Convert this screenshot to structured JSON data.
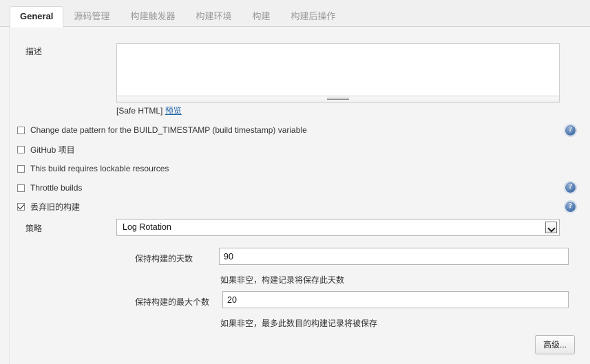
{
  "tabs": [
    {
      "label": "General",
      "active": true
    },
    {
      "label": "源码管理",
      "active": false
    },
    {
      "label": "构建触发器",
      "active": false
    },
    {
      "label": "构建环境",
      "active": false
    },
    {
      "label": "构建",
      "active": false
    },
    {
      "label": "构建后操作",
      "active": false
    }
  ],
  "description": {
    "label": "描述",
    "value": "",
    "placeholder": "",
    "safe_html_text": "[Safe HTML]",
    "preview_link": "预览"
  },
  "checkboxes": [
    {
      "label": "Change date pattern for the BUILD_TIMESTAMP (build timestamp) variable",
      "checked": false,
      "help": true
    },
    {
      "label": "GitHub 项目",
      "checked": false,
      "help": false
    },
    {
      "label": "This build requires lockable resources",
      "checked": false,
      "help": false
    },
    {
      "label": "Throttle builds",
      "checked": false,
      "help": true
    },
    {
      "label": "丢弃旧的构建",
      "checked": true,
      "help": true
    }
  ],
  "strategy": {
    "label": "策略",
    "selected": "Log Rotation",
    "options": [
      "Log Rotation"
    ]
  },
  "days_to_keep": {
    "label": "保持构建的天数",
    "value": "90",
    "hint": "如果非空，构建记录将保存此天数"
  },
  "num_to_keep": {
    "label": "保持构建的最大个数",
    "value": "20",
    "hint": "如果非空，最多此数目的构建记录将被保存"
  },
  "advanced_button": {
    "label": "高级..."
  },
  "icons": {
    "help": "help-icon",
    "dropdown": "chevron-down-icon"
  },
  "colors": {
    "link": "#2266aa",
    "help_blue": "#3e6ca3",
    "page_bg": "#f4f4f4",
    "tabbar_bg": "#f0f0f0"
  }
}
